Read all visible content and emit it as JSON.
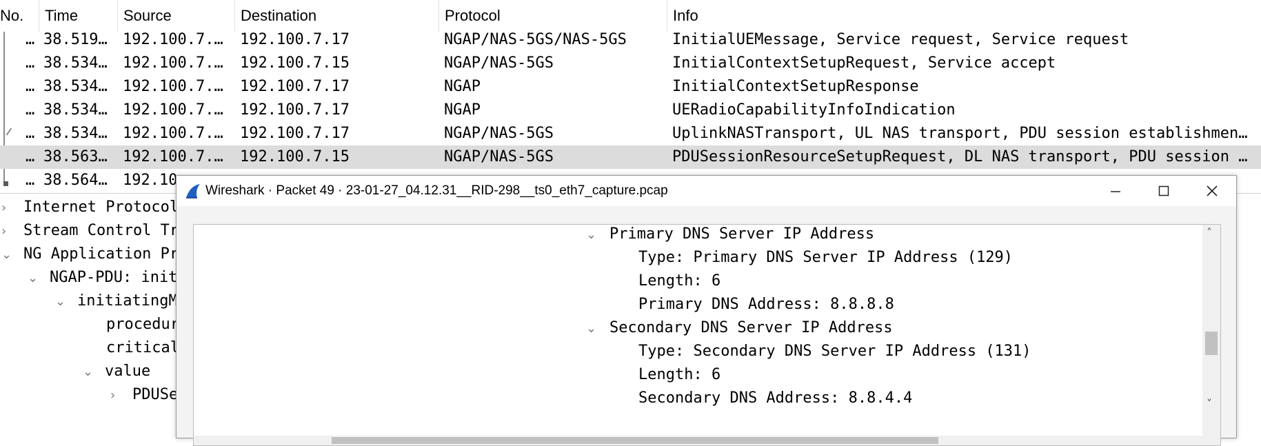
{
  "packet_list": {
    "columns": [
      "No.",
      "Time",
      "Source",
      "Destination",
      "Protocol",
      "Info"
    ],
    "rows": [
      {
        "no": "…",
        "time": "38.519…",
        "source": "192.100.7.…",
        "destination": "192.100.7.17",
        "protocol": "NGAP/NAS-5GS/NAS-5GS",
        "info": "InitialUEMessage, Service request, Service request"
      },
      {
        "no": "…",
        "time": "38.534…",
        "source": "192.100.7.…",
        "destination": "192.100.7.15",
        "protocol": "NGAP/NAS-5GS",
        "info": "InitialContextSetupRequest, Service accept"
      },
      {
        "no": "…",
        "time": "38.534…",
        "source": "192.100.7.…",
        "destination": "192.100.7.17",
        "protocol": "NGAP",
        "info": "InitialContextSetupResponse"
      },
      {
        "no": "…",
        "time": "38.534…",
        "source": "192.100.7.…",
        "destination": "192.100.7.17",
        "protocol": "NGAP",
        "info": "UERadioCapabilityInfoIndication"
      },
      {
        "no": "…",
        "time": "38.534…",
        "source": "192.100.7.…",
        "destination": "192.100.7.17",
        "protocol": "NGAP/NAS-5GS",
        "info": "UplinkNASTransport, UL NAS transport, PDU session establishmen…"
      },
      {
        "no": "…",
        "time": "38.563…",
        "source": "192.100.7.…",
        "destination": "192.100.7.15",
        "protocol": "NGAP/NAS-5GS",
        "info": "PDUSessionResourceSetupRequest, DL NAS transport, PDU session …",
        "selected": true
      },
      {
        "no": "…",
        "time": "38.564…",
        "source": "192.10",
        "destination": "",
        "protocol": "",
        "info": ""
      }
    ]
  },
  "detail_tree": [
    {
      "label": "Internet Protocol",
      "chevron": ">"
    },
    {
      "label": "Stream Control Tr",
      "chevron": ">"
    },
    {
      "label": "NG Application Pr",
      "chevron": "v"
    },
    {
      "label": "NGAP-PDU: init",
      "chevron": "v"
    },
    {
      "label": "initiatingM",
      "chevron": "v"
    },
    {
      "label": "procedur",
      "chevron": ""
    },
    {
      "label": "critical",
      "chevron": ""
    },
    {
      "label": "value",
      "chevron": "v"
    },
    {
      "label": "PDUSe",
      "chevron": ">"
    }
  ],
  "popup": {
    "title": "Wireshark · Packet 49 · 23-01-27_04.12.31__RID-298__ts0_eth7_capture.pcap",
    "minimize_icon": "minimize-icon",
    "maximize_icon": "maximize-icon",
    "close_icon": "close-icon",
    "lines": [
      {
        "text": "Primary DNS Server IP Address",
        "chevron": "v"
      },
      {
        "text": "Type: Primary DNS Server IP Address (129)",
        "chevron": ""
      },
      {
        "text": "Length: 6",
        "chevron": ""
      },
      {
        "text": "Primary DNS Address: 8.8.8.8",
        "chevron": ""
      },
      {
        "text": "Secondary DNS Server IP Address",
        "chevron": "v"
      },
      {
        "text": "Type: Secondary DNS Server IP Address (131)",
        "chevron": ""
      },
      {
        "text": "Length: 6",
        "chevron": ""
      },
      {
        "text": "Secondary DNS Address: 8.8.4.4",
        "chevron": ""
      }
    ]
  },
  "colors": {
    "selected_row": "#dcdcdc",
    "shark_fin": "#1f5fbf"
  }
}
